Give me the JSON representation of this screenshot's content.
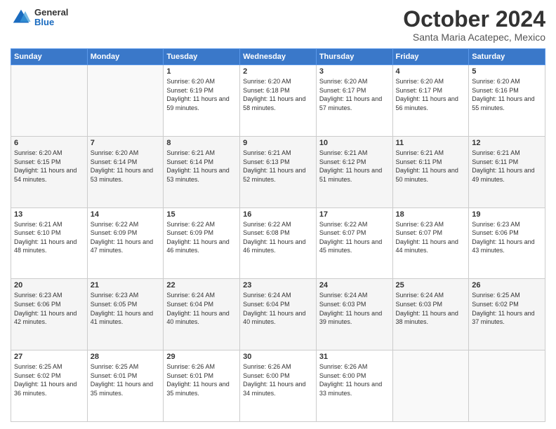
{
  "header": {
    "logo_general": "General",
    "logo_blue": "Blue",
    "month_title": "October 2024",
    "location": "Santa Maria Acatepec, Mexico"
  },
  "calendar": {
    "days_of_week": [
      "Sunday",
      "Monday",
      "Tuesday",
      "Wednesday",
      "Thursday",
      "Friday",
      "Saturday"
    ],
    "weeks": [
      {
        "days": [
          {
            "num": "",
            "empty": true
          },
          {
            "num": "",
            "empty": true
          },
          {
            "num": "1",
            "sunrise": "6:20 AM",
            "sunset": "6:19 PM",
            "daylight": "11 hours and 59 minutes."
          },
          {
            "num": "2",
            "sunrise": "6:20 AM",
            "sunset": "6:18 PM",
            "daylight": "11 hours and 58 minutes."
          },
          {
            "num": "3",
            "sunrise": "6:20 AM",
            "sunset": "6:17 PM",
            "daylight": "11 hours and 57 minutes."
          },
          {
            "num": "4",
            "sunrise": "6:20 AM",
            "sunset": "6:17 PM",
            "daylight": "11 hours and 56 minutes."
          },
          {
            "num": "5",
            "sunrise": "6:20 AM",
            "sunset": "6:16 PM",
            "daylight": "11 hours and 55 minutes."
          }
        ]
      },
      {
        "days": [
          {
            "num": "6",
            "sunrise": "6:20 AM",
            "sunset": "6:15 PM",
            "daylight": "11 hours and 54 minutes."
          },
          {
            "num": "7",
            "sunrise": "6:20 AM",
            "sunset": "6:14 PM",
            "daylight": "11 hours and 53 minutes."
          },
          {
            "num": "8",
            "sunrise": "6:21 AM",
            "sunset": "6:14 PM",
            "daylight": "11 hours and 53 minutes."
          },
          {
            "num": "9",
            "sunrise": "6:21 AM",
            "sunset": "6:13 PM",
            "daylight": "11 hours and 52 minutes."
          },
          {
            "num": "10",
            "sunrise": "6:21 AM",
            "sunset": "6:12 PM",
            "daylight": "11 hours and 51 minutes."
          },
          {
            "num": "11",
            "sunrise": "6:21 AM",
            "sunset": "6:11 PM",
            "daylight": "11 hours and 50 minutes."
          },
          {
            "num": "12",
            "sunrise": "6:21 AM",
            "sunset": "6:11 PM",
            "daylight": "11 hours and 49 minutes."
          }
        ]
      },
      {
        "days": [
          {
            "num": "13",
            "sunrise": "6:21 AM",
            "sunset": "6:10 PM",
            "daylight": "11 hours and 48 minutes."
          },
          {
            "num": "14",
            "sunrise": "6:22 AM",
            "sunset": "6:09 PM",
            "daylight": "11 hours and 47 minutes."
          },
          {
            "num": "15",
            "sunrise": "6:22 AM",
            "sunset": "6:09 PM",
            "daylight": "11 hours and 46 minutes."
          },
          {
            "num": "16",
            "sunrise": "6:22 AM",
            "sunset": "6:08 PM",
            "daylight": "11 hours and 46 minutes."
          },
          {
            "num": "17",
            "sunrise": "6:22 AM",
            "sunset": "6:07 PM",
            "daylight": "11 hours and 45 minutes."
          },
          {
            "num": "18",
            "sunrise": "6:23 AM",
            "sunset": "6:07 PM",
            "daylight": "11 hours and 44 minutes."
          },
          {
            "num": "19",
            "sunrise": "6:23 AM",
            "sunset": "6:06 PM",
            "daylight": "11 hours and 43 minutes."
          }
        ]
      },
      {
        "days": [
          {
            "num": "20",
            "sunrise": "6:23 AM",
            "sunset": "6:06 PM",
            "daylight": "11 hours and 42 minutes."
          },
          {
            "num": "21",
            "sunrise": "6:23 AM",
            "sunset": "6:05 PM",
            "daylight": "11 hours and 41 minutes."
          },
          {
            "num": "22",
            "sunrise": "6:24 AM",
            "sunset": "6:04 PM",
            "daylight": "11 hours and 40 minutes."
          },
          {
            "num": "23",
            "sunrise": "6:24 AM",
            "sunset": "6:04 PM",
            "daylight": "11 hours and 40 minutes."
          },
          {
            "num": "24",
            "sunrise": "6:24 AM",
            "sunset": "6:03 PM",
            "daylight": "11 hours and 39 minutes."
          },
          {
            "num": "25",
            "sunrise": "6:24 AM",
            "sunset": "6:03 PM",
            "daylight": "11 hours and 38 minutes."
          },
          {
            "num": "26",
            "sunrise": "6:25 AM",
            "sunset": "6:02 PM",
            "daylight": "11 hours and 37 minutes."
          }
        ]
      },
      {
        "days": [
          {
            "num": "27",
            "sunrise": "6:25 AM",
            "sunset": "6:02 PM",
            "daylight": "11 hours and 36 minutes."
          },
          {
            "num": "28",
            "sunrise": "6:25 AM",
            "sunset": "6:01 PM",
            "daylight": "11 hours and 35 minutes."
          },
          {
            "num": "29",
            "sunrise": "6:26 AM",
            "sunset": "6:01 PM",
            "daylight": "11 hours and 35 minutes."
          },
          {
            "num": "30",
            "sunrise": "6:26 AM",
            "sunset": "6:00 PM",
            "daylight": "11 hours and 34 minutes."
          },
          {
            "num": "31",
            "sunrise": "6:26 AM",
            "sunset": "6:00 PM",
            "daylight": "11 hours and 33 minutes."
          },
          {
            "num": "",
            "empty": true
          },
          {
            "num": "",
            "empty": true
          }
        ]
      }
    ]
  }
}
